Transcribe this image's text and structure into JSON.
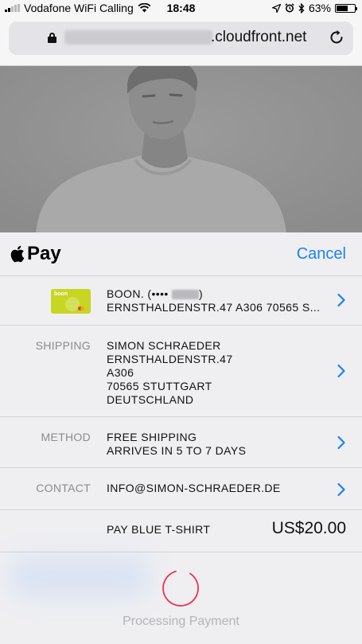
{
  "status_bar": {
    "carrier": "Vodafone WiFi Calling",
    "time": "18:48",
    "battery": "63%",
    "battery_level": 0.63
  },
  "browser": {
    "url_domain": ".cloudfront.net"
  },
  "sheet": {
    "brand_text": "Pay",
    "cancel_label": "Cancel",
    "card": {
      "thumb_brand": "boon",
      "name": "BOON. (••••",
      "name_suffix": ")",
      "address": "ERNSTHALDENSTR.47 A306 70565 S..."
    },
    "shipping": {
      "label": "SHIPPING",
      "lines": [
        "SIMON SCHRAEDER",
        "ERNSTHALDENSTR.47",
        "A306",
        "70565 STUTTGART",
        "DEUTSCHLAND"
      ]
    },
    "method": {
      "label": "METHOD",
      "lines": [
        "FREE SHIPPING",
        "ARRIVES IN 5 TO 7 DAYS"
      ]
    },
    "contact": {
      "label": "CONTACT",
      "value": "INFO@SIMON-SCHRAEDER.DE"
    },
    "total": {
      "label": "PAY BLUE T-SHIRT",
      "amount": "US$20.00"
    },
    "processing_text": "Processing Payment"
  },
  "colors": {
    "accent": "#1a82f1",
    "spinner": "#f0304a",
    "card": "#c6d623"
  },
  "icons": {
    "wifi": "wifi-icon",
    "location": "location-arrow-icon",
    "alarm": "alarm-icon",
    "bluetooth": "bluetooth-icon",
    "lock": "lock-icon",
    "reload": "reload-icon",
    "apple": "apple-logo-icon",
    "chevron": "chevron-right-icon"
  }
}
